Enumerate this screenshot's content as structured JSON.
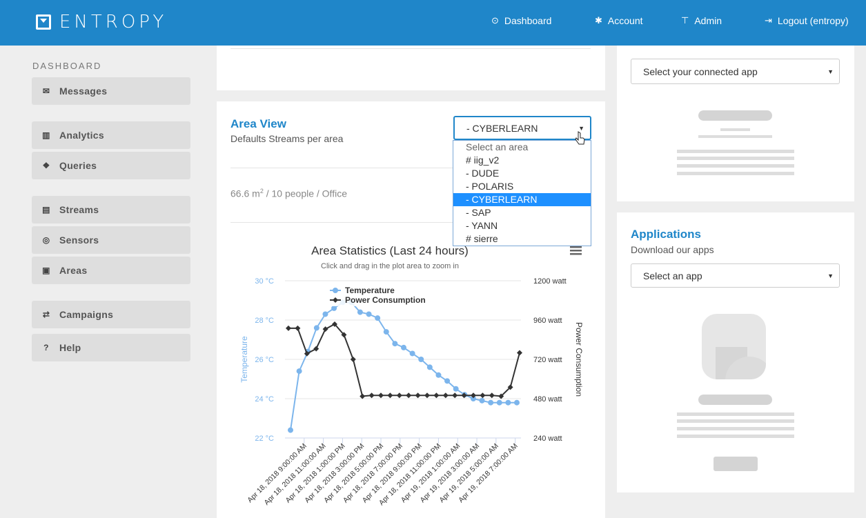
{
  "brand": {
    "name": "ENTROPY"
  },
  "nav": [
    {
      "icon": "dashboard-icon",
      "glyph": "⊙",
      "label": "Dashboard"
    },
    {
      "icon": "gear-icon",
      "glyph": "✱",
      "label": "Account"
    },
    {
      "icon": "pin-icon",
      "glyph": "⊤",
      "label": "Admin"
    },
    {
      "icon": "logout-icon",
      "glyph": "⇥",
      "label": "Logout (entropy)"
    }
  ],
  "sidebar": {
    "heading": "DASHBOARD",
    "items": [
      {
        "label": "Messages",
        "glyph": "✉"
      },
      {
        "label": "Analytics",
        "glyph": "▥"
      },
      {
        "label": "Queries",
        "glyph": "❖"
      },
      {
        "label": "Streams",
        "glyph": "▤"
      },
      {
        "label": "Sensors",
        "glyph": "◎"
      },
      {
        "label": "Areas",
        "glyph": "▣"
      },
      {
        "label": "Campaigns",
        "glyph": "⇄"
      },
      {
        "label": "Help",
        "glyph": "?"
      }
    ]
  },
  "area_view": {
    "title": "Area View",
    "subtitle": "Defaults Streams per area",
    "selected": "- CYBERLEARN",
    "options": [
      "Select an area",
      "# iig_v2",
      "- DUDE",
      "- POLARIS",
      "- CYBERLEARN",
      "- SAP",
      "- YANN",
      "# sierre"
    ],
    "meta_prefix": "66.6 m",
    "meta_sup": "2",
    "meta_suffix": " / 10 people / Office"
  },
  "connected_app": {
    "placeholder": "Select your connected app"
  },
  "applications": {
    "title": "Applications",
    "subtitle": "Download our apps",
    "placeholder": "Select an app"
  },
  "chart_data": {
    "type": "line",
    "title": "Area Statistics (Last 24 hours)",
    "subtitle": "Click and drag in the plot area to zoom in",
    "ylabel_left": "Temperature",
    "ylabel_right": "Power Consumption",
    "y_left_ticks": [
      "30 °C",
      "28 °C",
      "26 °C",
      "24 °C",
      "22 °C"
    ],
    "y_left_range": [
      22,
      30
    ],
    "y_right_ticks": [
      "1200 watt",
      "960 watt",
      "720 watt",
      "480 watt",
      "240 watt"
    ],
    "y_right_range": [
      240,
      1200
    ],
    "x_labels": [
      "Apr 18, 2018 9:00:00 AM",
      "Apr 18, 2018 11:00:00 AM",
      "Apr 18, 2018 1:00:00 PM",
      "Apr 18, 2018 3:00:00 PM",
      "Apr 18, 2018 5:00:00 PM",
      "Apr 18, 2018 7:00:00 PM",
      "Apr 18, 2018 9:00:00 PM",
      "Apr 18, 2018 11:00:00 PM",
      "Apr 19, 2018 1:00:00 AM",
      "Apr 19, 2018 3:00:00 AM",
      "Apr 19, 2018 5:00:00 AM",
      "Apr 19, 2018 7:00:00 AM"
    ],
    "series": [
      {
        "name": "Temperature",
        "color": "#7cb5ec",
        "axis": "left",
        "values": [
          22.4,
          25.4,
          26.4,
          27.6,
          28.3,
          28.6,
          28.9,
          28.9,
          28.4,
          28.3,
          28.1,
          27.4,
          26.8,
          26.6,
          26.3,
          26.0,
          25.6,
          25.2,
          24.9,
          24.5,
          24.2,
          24.0,
          23.9,
          23.8,
          23.8,
          23.8,
          23.8
        ]
      },
      {
        "name": "Power Consumption",
        "color": "#333333",
        "axis": "right",
        "values": [
          910,
          910,
          755,
          785,
          905,
          935,
          870,
          720,
          495,
          500,
          500,
          500,
          500,
          500,
          500,
          500,
          500,
          500,
          500,
          500,
          500,
          500,
          500,
          495,
          550,
          760
        ]
      }
    ],
    "legend_position": "top-left",
    "grid": true
  }
}
